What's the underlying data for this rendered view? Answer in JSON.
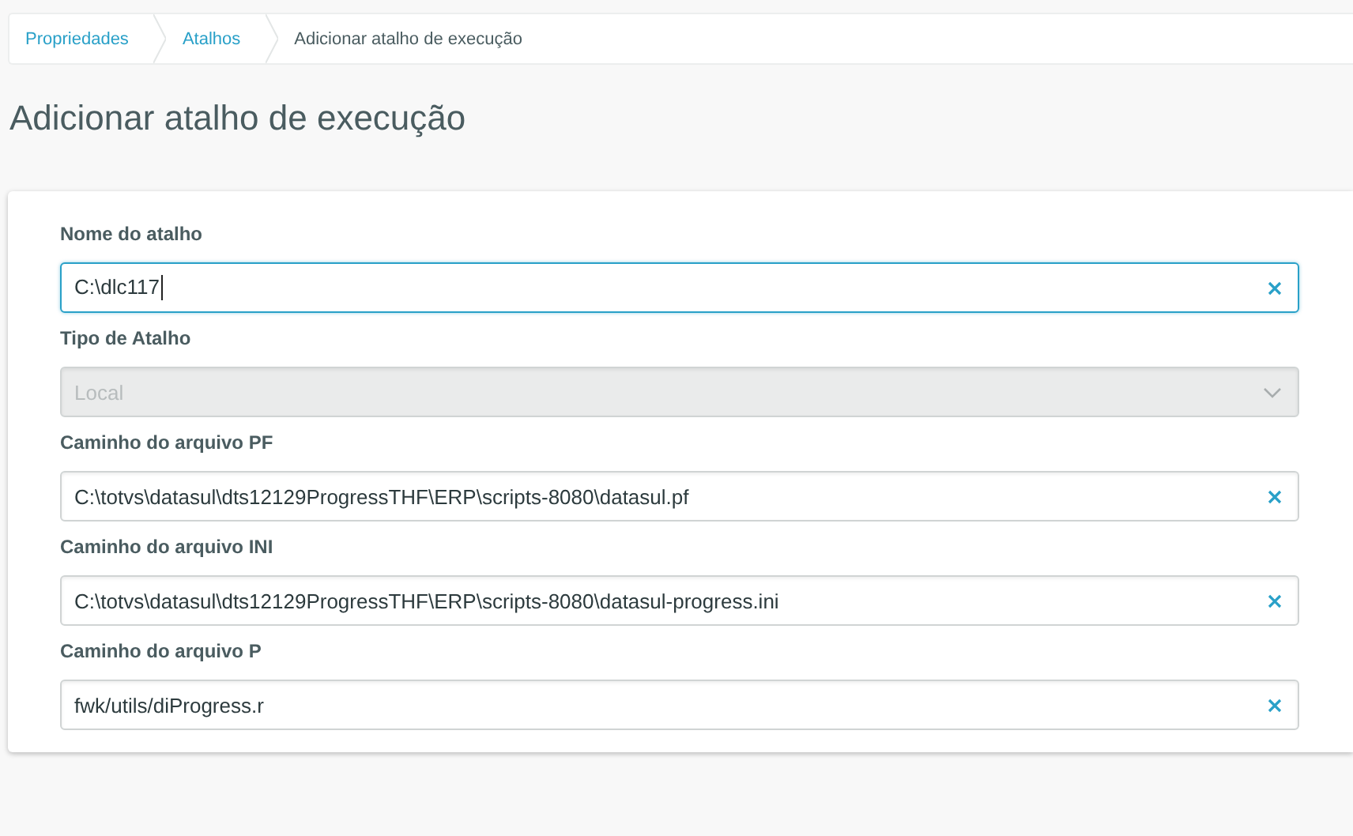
{
  "breadcrumb": [
    {
      "label": "Propriedades",
      "selected": false
    },
    {
      "label": "Atalhos",
      "selected": false
    },
    {
      "label": "Adicionar atalho de execução",
      "selected": true
    }
  ],
  "page_title": "Adicionar atalho de execução",
  "fields": [
    {
      "kind": "text",
      "label": "Nome do atalho",
      "value": "C:\\dlc117",
      "focused": true,
      "disabled": false
    },
    {
      "kind": "select",
      "label": "Tipo de Atalho",
      "value": "Local",
      "focused": false,
      "disabled": true
    },
    {
      "kind": "text",
      "label": "Caminho do arquivo PF",
      "value": "C:\\totvs\\datasul\\dts12129ProgressTHF\\ERP\\scripts-8080\\datasul.pf",
      "focused": false,
      "disabled": false
    },
    {
      "kind": "text",
      "label": "Caminho do arquivo INI",
      "value": "C:\\totvs\\datasul\\dts12129ProgressTHF\\ERP\\scripts-8080\\datasul-progress.ini",
      "focused": false,
      "disabled": false
    },
    {
      "kind": "text",
      "label": "Caminho do arquivo P",
      "value": "fwk/utils/diProgress.r",
      "focused": false,
      "disabled": false
    }
  ]
}
